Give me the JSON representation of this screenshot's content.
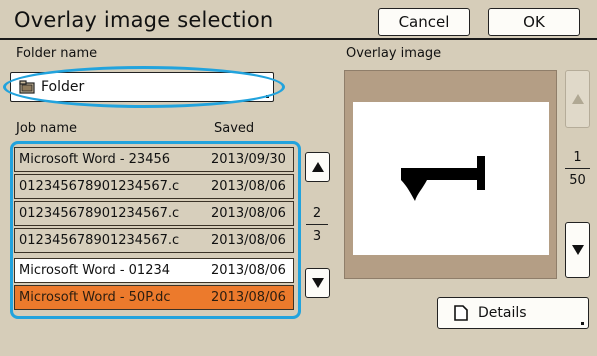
{
  "header": {
    "title": "Overlay image selection",
    "cancel_label": "Cancel",
    "ok_label": "OK"
  },
  "folder": {
    "label": "Folder name",
    "value": "Folder"
  },
  "list": {
    "col_job": "Job name",
    "col_saved": "Saved",
    "rows": [
      {
        "name": "Microsoft Word - 23456",
        "saved": "2013/09/30",
        "state": "dim"
      },
      {
        "name": "012345678901234567.c",
        "saved": "2013/08/06",
        "state": "dim"
      },
      {
        "name": "012345678901234567.c",
        "saved": "2013/08/06",
        "state": "dim"
      },
      {
        "name": "012345678901234567.c",
        "saved": "2013/08/06",
        "state": "dim"
      },
      {
        "name": "Microsoft Word - 01234",
        "saved": "2013/08/06",
        "state": "white"
      },
      {
        "name": "Microsoft Word - 50P.dc",
        "saved": "2013/08/06",
        "state": "selected"
      }
    ],
    "page_current": "2",
    "page_total": "3"
  },
  "preview": {
    "label": "Overlay image",
    "page_current": "1",
    "page_total": "50"
  },
  "details_label": "Details",
  "icons": {
    "folder": "folder-icon",
    "details": "document-icon",
    "up": "triangle-up-icon",
    "down": "triangle-down-icon"
  },
  "colors": {
    "highlight": "#22a3dd",
    "selected_row": "#ec7a2c",
    "background": "#d6cdb9"
  }
}
